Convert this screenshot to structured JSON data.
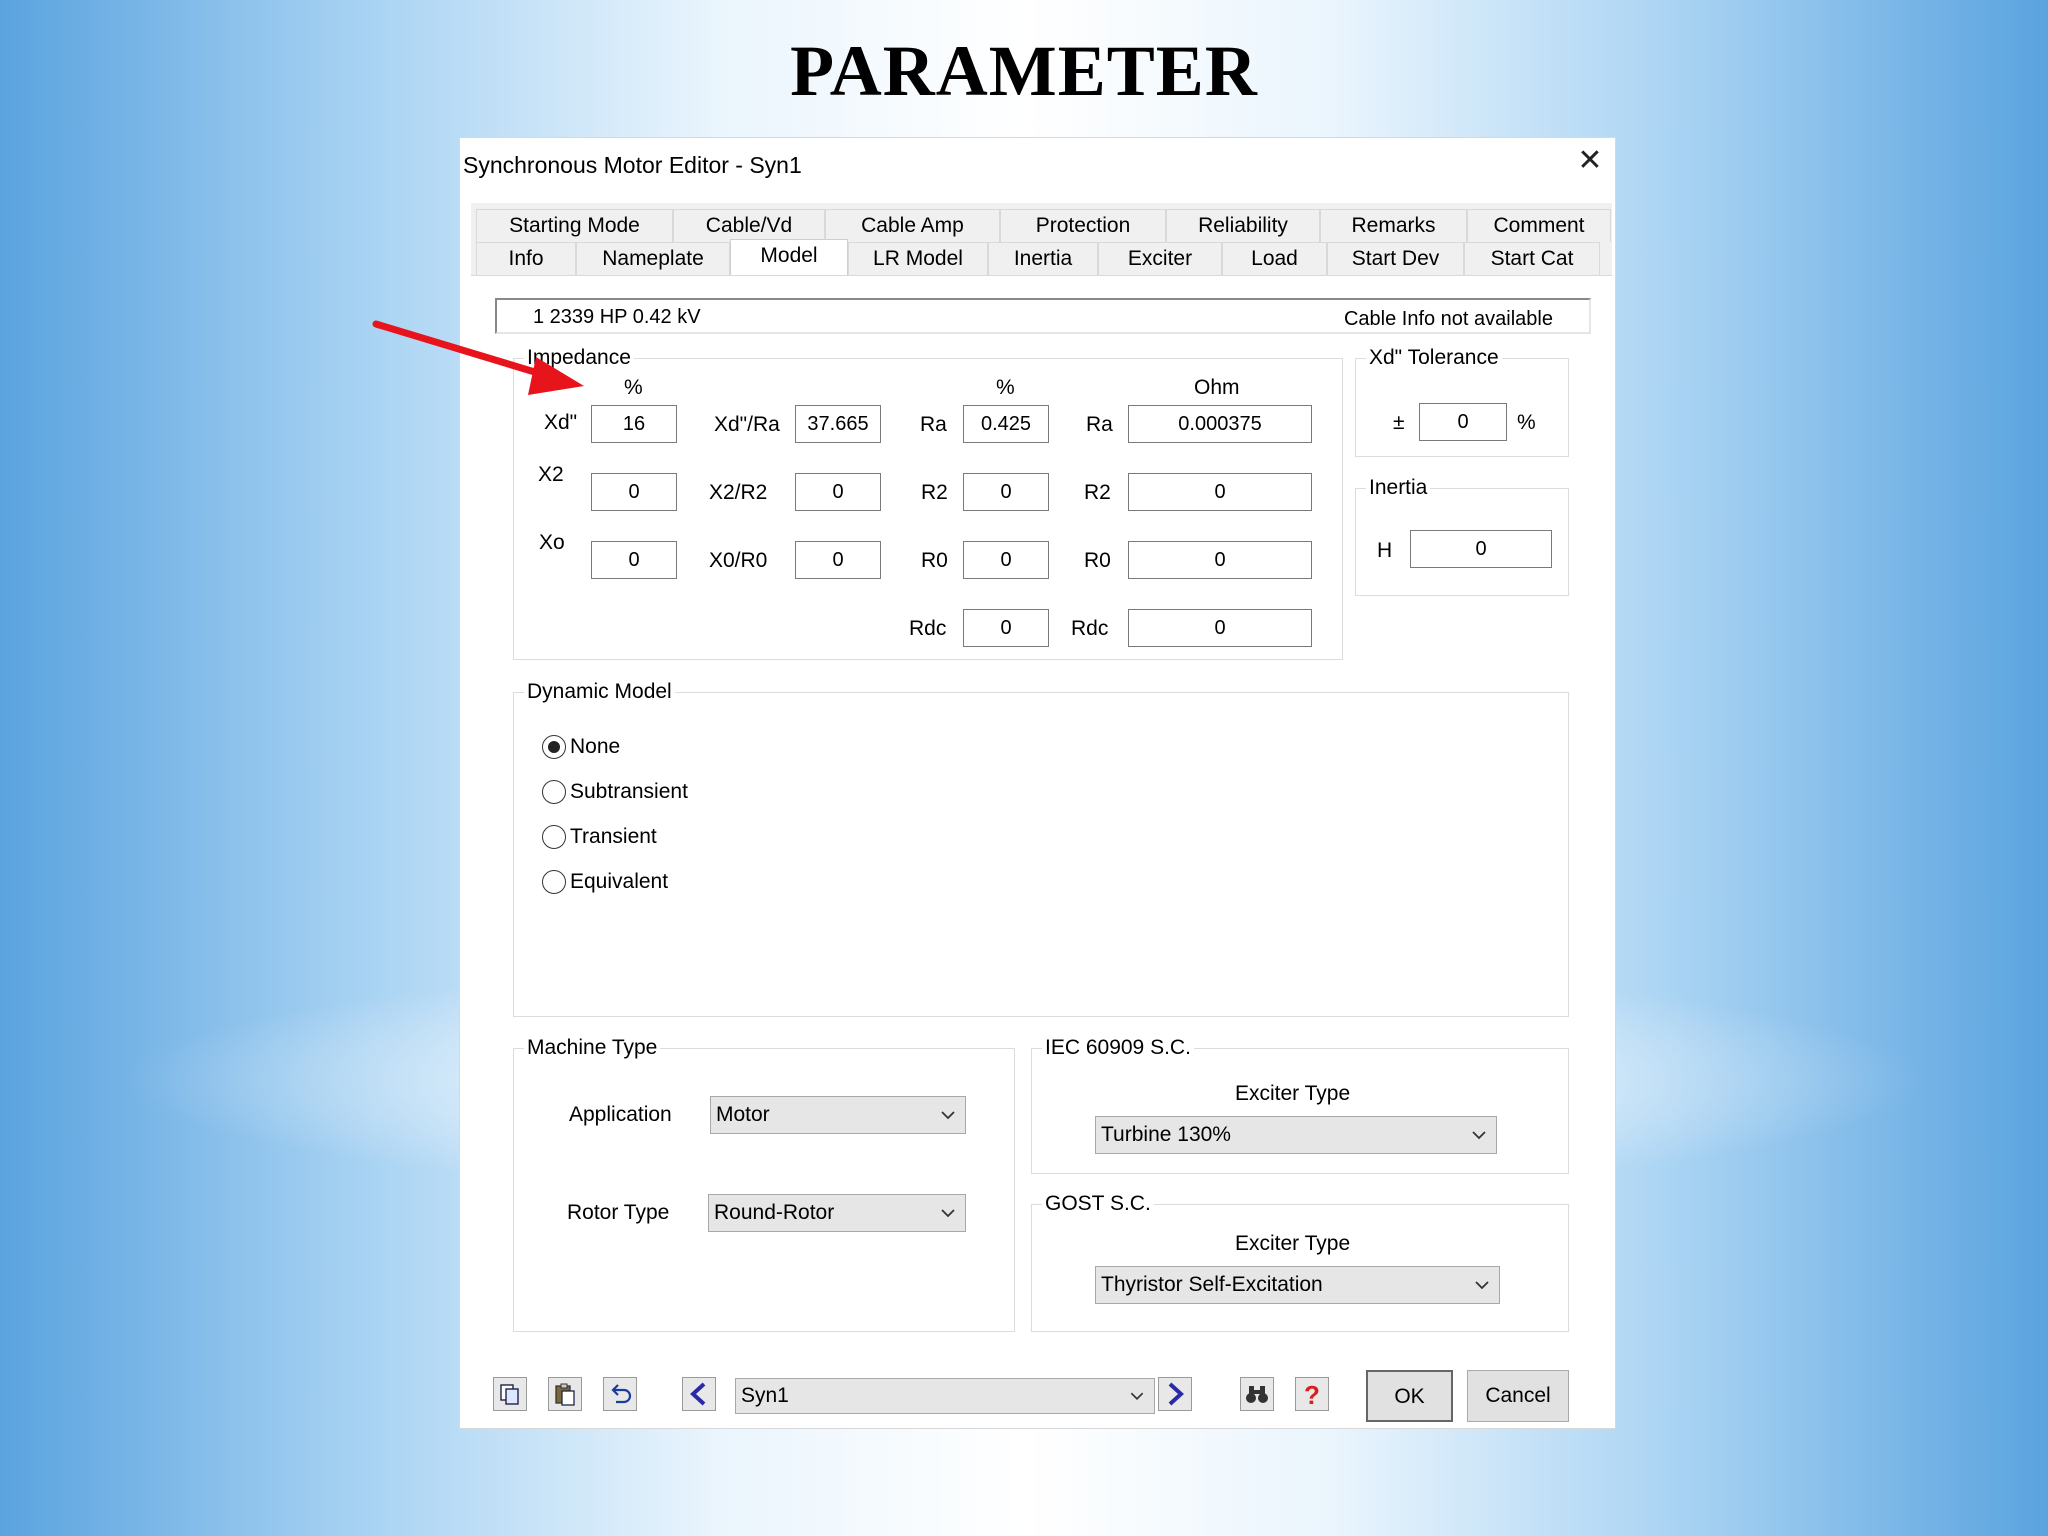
{
  "slide": {
    "title": "PARAMETER"
  },
  "dialog": {
    "title": "Synchronous Motor Editor - Syn1",
    "tabs_row1": [
      "Starting Mode",
      "Cable/Vd",
      "Cable Amp",
      "Protection",
      "Reliability",
      "Remarks",
      "Comment"
    ],
    "tabs_row2": [
      "Info",
      "Nameplate",
      "Model",
      "LR Model",
      "Inertia",
      "Exciter",
      "Load",
      "Start Dev",
      "Start Cat"
    ],
    "active_tab": "Model",
    "info_left": "1   2339 HP   0.42 kV",
    "info_right": "Cable Info not available",
    "impedance": {
      "legend": "Impedance",
      "pct_header1": "%",
      "pct_header2": "%",
      "ohm_header": "Ohm",
      "rows": [
        {
          "x_label": "Xd\"",
          "x_val": "16",
          "xr_label": "Xd\"/Ra",
          "xr_val": "37.665",
          "r_label": "Ra",
          "r_val": "0.425",
          "ohm_label": "Ra",
          "ohm_val": "0.000375"
        },
        {
          "x_label": "X2",
          "x_val": "0",
          "xr_label": "X2/R2",
          "xr_val": "0",
          "r_label": "R2",
          "r_val": "0",
          "ohm_label": "R2",
          "ohm_val": "0"
        },
        {
          "x_label": "Xo",
          "x_val": "0",
          "xr_label": "X0/R0",
          "xr_val": "0",
          "r_label": "R0",
          "r_val": "0",
          "ohm_label": "R0",
          "ohm_val": "0"
        }
      ],
      "rdc_label": "Rdc",
      "rdc_val": "0",
      "rdc_ohm_label": "Rdc",
      "rdc_ohm_val": "0"
    },
    "tolerance": {
      "legend": "Xd\"  Tolerance",
      "pm": "±",
      "value": "0",
      "unit": "%"
    },
    "inertia": {
      "legend": "Inertia",
      "h_label": "H",
      "h_val": "0"
    },
    "dynamic_model": {
      "legend": "Dynamic Model",
      "options": [
        "None",
        "Subtransient",
        "Transient",
        "Equivalent"
      ],
      "selected": "None"
    },
    "machine_type": {
      "legend": "Machine Type",
      "application_label": "Application",
      "application_value": "Motor",
      "rotor_label": "Rotor Type",
      "rotor_value": "Round-Rotor"
    },
    "iec": {
      "legend": "IEC 60909 S.C.",
      "exciter_label": "Exciter Type",
      "exciter_value": "Turbine 130%"
    },
    "gost": {
      "legend": "GOST S.C.",
      "exciter_label": "Exciter Type",
      "exciter_value": "Thyristor Self-Excitation"
    },
    "footer": {
      "element_value": "Syn1",
      "ok_label": "OK",
      "cancel_label": "Cancel"
    },
    "accent_colors": {
      "annotation_arrow": "#e8141c",
      "nav_arrow": "#2a2aa8",
      "help": "#d81e1e"
    }
  }
}
